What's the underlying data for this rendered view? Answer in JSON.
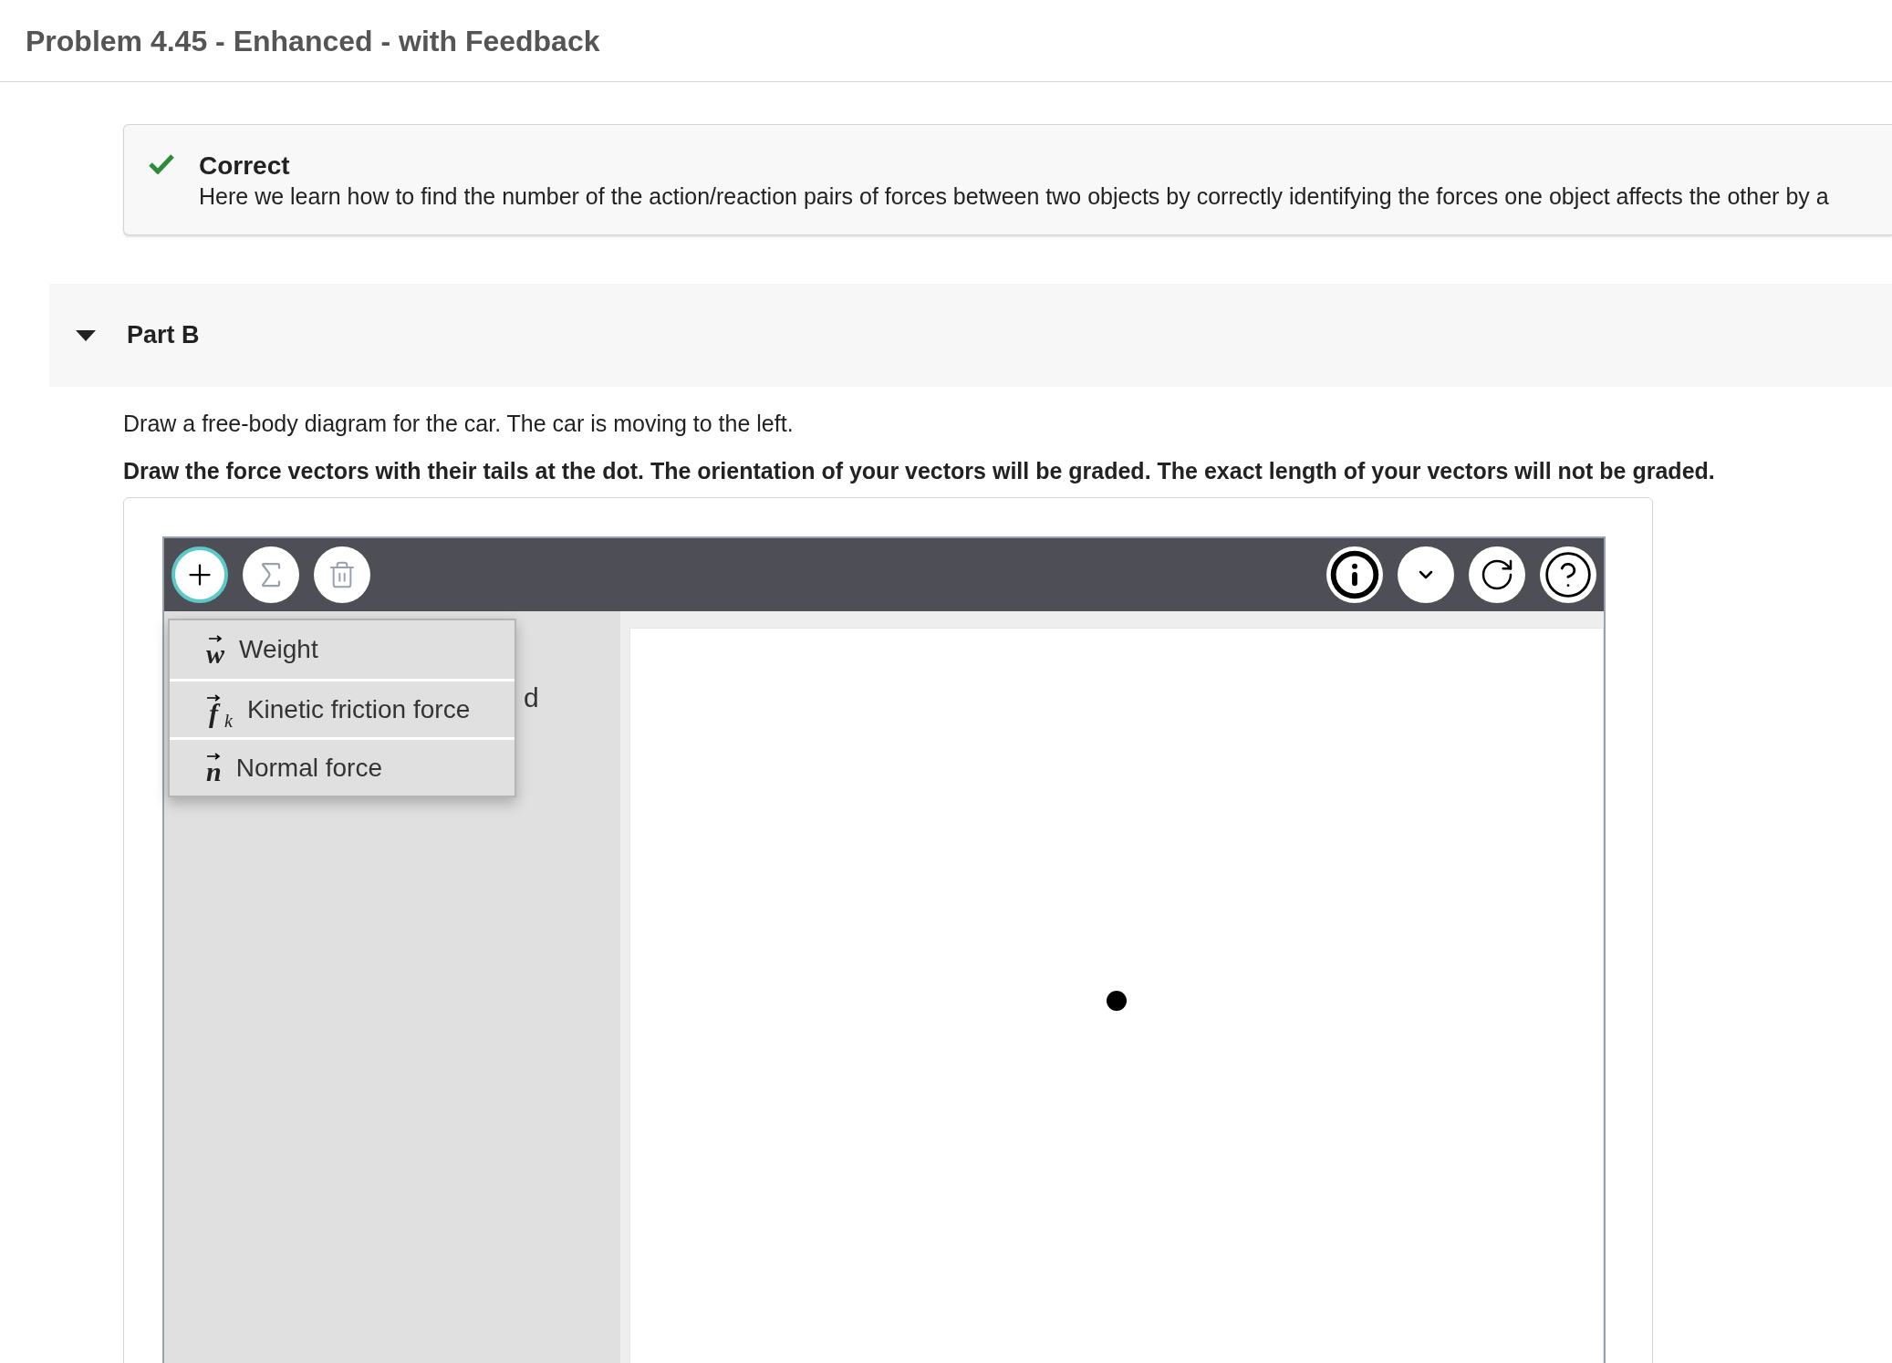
{
  "header": {
    "title": "Problem 4.45 - Enhanced - with Feedback"
  },
  "feedback": {
    "status": "Correct",
    "correct": true,
    "message": "Here we learn how to find the number of the action/reaction pairs of forces between two objects by correctly identifying the forces one object affects the other by a"
  },
  "part": {
    "title": "Part B",
    "expanded": true,
    "prompt": "Draw a free-body diagram for the car. The car is moving to the left.",
    "instruction": "Draw the force vectors with their tails at the dot. The orientation of your vectors will be graded. The exact length of your vectors will not be graded."
  },
  "tool": {
    "toolbar_left": [
      {
        "kind": "add",
        "selected": true
      },
      {
        "kind": "sum",
        "selected": false
      },
      {
        "kind": "trash",
        "selected": false
      }
    ],
    "toolbar_right": [
      {
        "kind": "info"
      },
      {
        "kind": "chevron"
      },
      {
        "kind": "reset"
      },
      {
        "kind": "help"
      }
    ],
    "menu_open": true,
    "menu": [
      {
        "symbol": "w",
        "label": "Weight"
      },
      {
        "symbol": "f",
        "subscript": "k",
        "label": "Kinetic friction force"
      },
      {
        "symbol": "n",
        "label": "Normal force"
      }
    ],
    "panel_text": "d"
  }
}
